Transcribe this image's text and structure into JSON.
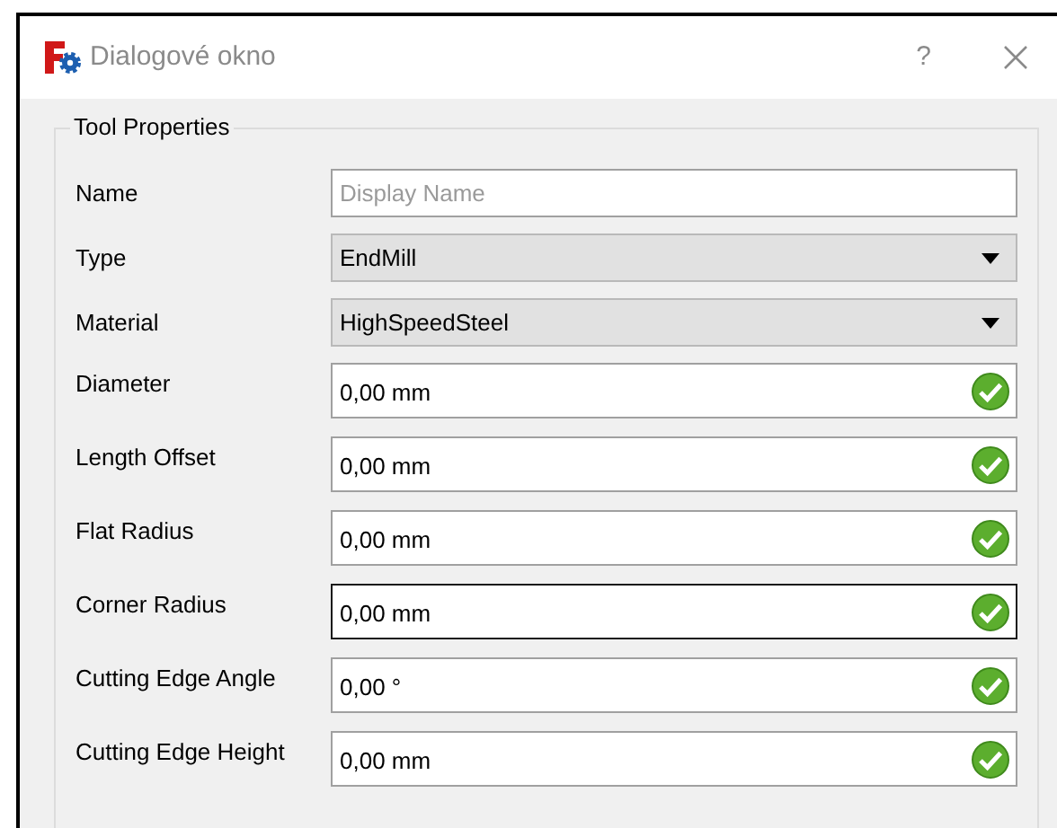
{
  "window": {
    "title": "Dialogové okno",
    "help": "?"
  },
  "group": {
    "title": "Tool Properties",
    "fields": [
      {
        "kind": "text",
        "label": "Name",
        "placeholder": "Display Name"
      },
      {
        "kind": "combo",
        "label": "Type",
        "value": "EndMill"
      },
      {
        "kind": "combo",
        "label": "Material",
        "value": "HighSpeedSteel"
      },
      {
        "kind": "quantity",
        "label": "Diameter",
        "value": "0,00 mm",
        "valid": true,
        "focused": false
      },
      {
        "kind": "quantity",
        "label": "Length Offset",
        "value": "0,00 mm",
        "valid": true,
        "focused": false
      },
      {
        "kind": "quantity",
        "label": "Flat Radius",
        "value": "0,00 mm",
        "valid": true,
        "focused": false
      },
      {
        "kind": "quantity",
        "label": "Corner Radius",
        "value": "0,00 mm",
        "valid": true,
        "focused": true
      },
      {
        "kind": "quantity",
        "label": "Cutting Edge Angle",
        "value": "0,00 °",
        "valid": true,
        "focused": false
      },
      {
        "kind": "quantity",
        "label": "Cutting Edge Height",
        "value": "0,00 mm",
        "valid": true,
        "focused": false
      }
    ]
  }
}
